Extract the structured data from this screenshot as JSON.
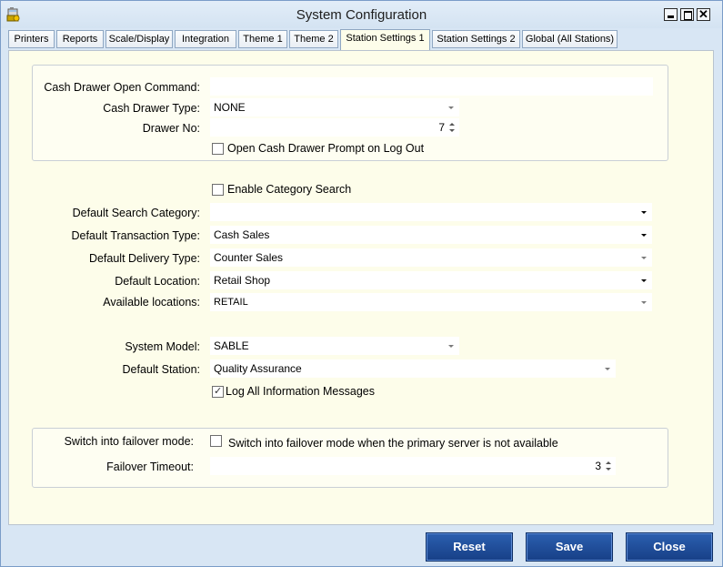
{
  "window": {
    "title": "System Configuration"
  },
  "tabs": [
    {
      "label": "Printers",
      "active": false
    },
    {
      "label": "Reports",
      "active": false
    },
    {
      "label": "Scale/Display",
      "active": false
    },
    {
      "label": "Integration",
      "active": false
    },
    {
      "label": "Theme 1",
      "active": false
    },
    {
      "label": "Theme 2",
      "active": false
    },
    {
      "label": "Station Settings 1",
      "active": true
    },
    {
      "label": "Station Settings 2",
      "active": false
    },
    {
      "label": "Global (All Stations)",
      "active": false
    }
  ],
  "cash_drawer": {
    "open_command_label": "Cash Drawer Open Command:",
    "open_command_value": "",
    "type_label": "Cash Drawer Type:",
    "type_value": "NONE",
    "drawer_no_label": "Drawer No:",
    "drawer_no_value": "7",
    "prompt_logout_label": "Open Cash Drawer Prompt on Log Out",
    "prompt_logout_checked": false
  },
  "defaults": {
    "enable_category_search_label": "Enable Category Search",
    "enable_category_search_checked": false,
    "search_category_label": "Default Search Category:",
    "search_category_value": "",
    "transaction_type_label": "Default Transaction Type:",
    "transaction_type_value": "Cash Sales",
    "delivery_type_label": "Default Delivery Type:",
    "delivery_type_value": "Counter Sales",
    "location_label": "Default Location:",
    "location_value": "Retail Shop",
    "available_locations_label": "Available locations:",
    "available_locations_value": "RETAIL"
  },
  "system": {
    "model_label": "System Model:",
    "model_value": "SABLE",
    "station_label": "Default Station:",
    "station_value": "Quality Assurance",
    "log_messages_label": "Log All Information Messages",
    "log_messages_checked": true
  },
  "failover": {
    "mode_label": "Switch into failover mode:",
    "mode_checkbox_label": "Switch into failover mode when the primary server is not available",
    "mode_checked": false,
    "timeout_label": "Failover Timeout:",
    "timeout_value": "3"
  },
  "buttons": {
    "reset": "Reset",
    "save": "Save",
    "close": "Close"
  },
  "icons": {
    "app": "cash-register-icon",
    "minimize": "minimize-icon",
    "maximize": "maximize-icon",
    "close": "close-icon",
    "dropdown": "chevron-down-icon",
    "spin": "spin-up-down-icon",
    "check": "checkmark-icon"
  }
}
